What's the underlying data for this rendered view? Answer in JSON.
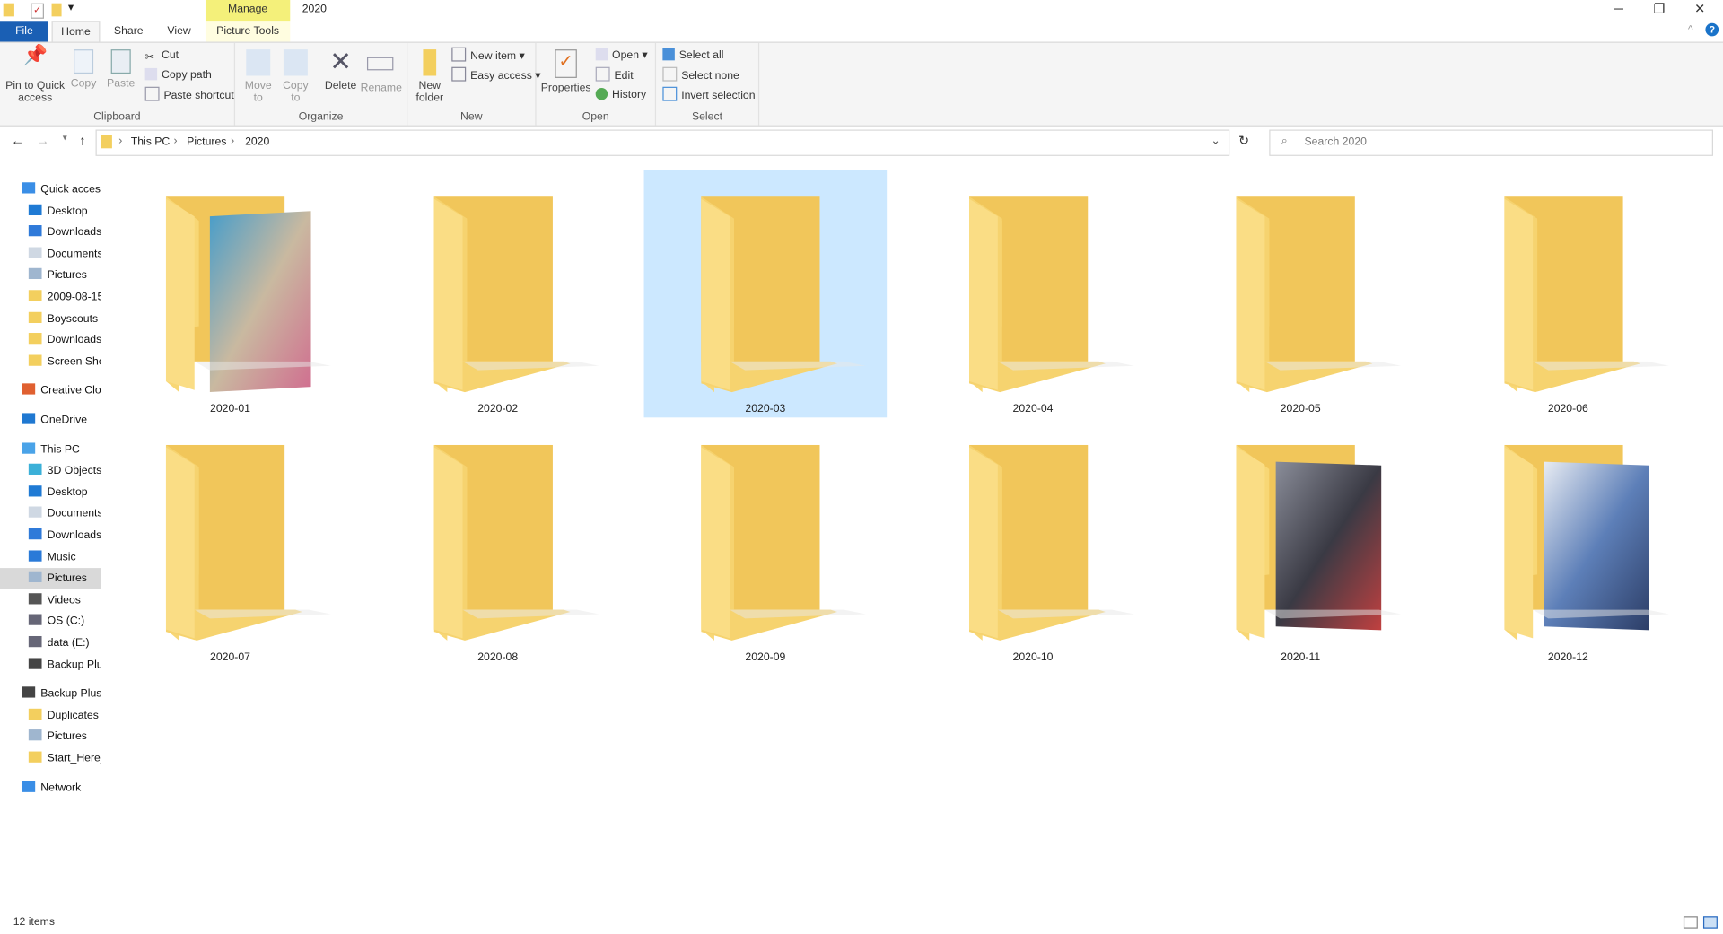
{
  "window": {
    "title": "2020",
    "context_tab": "Manage",
    "minimize": "─",
    "restore": "❐",
    "close": "✕"
  },
  "tabs": [
    {
      "label": "File"
    },
    {
      "label": "Home"
    },
    {
      "label": "Share"
    },
    {
      "label": "View"
    },
    {
      "label": "Picture Tools"
    }
  ],
  "ribbon": {
    "clipboard": {
      "label": "Clipboard",
      "pin": "Pin to Quick access",
      "copy": "Copy",
      "paste": "Paste",
      "cut": "Cut",
      "copy_path": "Copy path",
      "paste_shortcut": "Paste shortcut"
    },
    "organize": {
      "label": "Organize",
      "move_to": "Move to",
      "copy_to": "Copy to",
      "delete": "Delete",
      "rename": "Rename"
    },
    "new": {
      "label": "New",
      "new_folder": "New folder",
      "new_item": "New item ▾",
      "easy_access": "Easy access ▾"
    },
    "open": {
      "label": "Open",
      "properties": "Properties",
      "open": "Open ▾",
      "edit": "Edit",
      "history": "History"
    },
    "select": {
      "label": "Select",
      "select_all": "Select all",
      "select_none": "Select none",
      "invert": "Invert selection"
    }
  },
  "address": {
    "path": [
      "This PC",
      "Pictures",
      "2020"
    ],
    "search_placeholder": "Search 2020"
  },
  "sidebar": [
    {
      "label": "Quick access",
      "icon": "star-icon",
      "level": 0
    },
    {
      "label": "Desktop",
      "icon": "desktop-icon",
      "level": 1,
      "pinned": true
    },
    {
      "label": "Downloads",
      "icon": "download-icon",
      "level": 1,
      "pinned": true
    },
    {
      "label": "Documents",
      "icon": "document-icon",
      "level": 1,
      "pinned": true
    },
    {
      "label": "Pictures",
      "icon": "pictures-icon",
      "level": 1,
      "pinned": true
    },
    {
      "label": "2009-08-15",
      "icon": "folder-icon",
      "level": 1
    },
    {
      "label": "Boyscouts",
      "icon": "folder-icon",
      "level": 1
    },
    {
      "label": "Downloads",
      "icon": "folder-icon",
      "level": 1
    },
    {
      "label": "Screen Shots",
      "icon": "folder-icon",
      "level": 1
    },
    {
      "label": "Creative Cloud Files",
      "icon": "creative-cloud-icon",
      "level": 0,
      "gap": true
    },
    {
      "label": "OneDrive",
      "icon": "cloud-icon",
      "level": 0,
      "gap": true
    },
    {
      "label": "This PC",
      "icon": "computer-icon",
      "level": 0,
      "gap": true
    },
    {
      "label": "3D Objects",
      "icon": "cube-icon",
      "level": 1
    },
    {
      "label": "Desktop",
      "icon": "desktop-icon",
      "level": 1
    },
    {
      "label": "Documents",
      "icon": "document-icon",
      "level": 1
    },
    {
      "label": "Downloads",
      "icon": "download-icon",
      "level": 1
    },
    {
      "label": "Music",
      "icon": "music-icon",
      "level": 1
    },
    {
      "label": "Pictures",
      "icon": "pictures-icon",
      "level": 1,
      "selected": true
    },
    {
      "label": "Videos",
      "icon": "video-icon",
      "level": 1
    },
    {
      "label": "OS (C:)",
      "icon": "drive-icon",
      "level": 1
    },
    {
      "label": "data (E:)",
      "icon": "drive-icon",
      "level": 1
    },
    {
      "label": "Backup Plus",
      "icon": "external-drive-icon",
      "level": 1
    },
    {
      "label": "Backup Plus",
      "icon": "external-drive-icon",
      "level": 0,
      "gap": true
    },
    {
      "label": "Duplicates",
      "icon": "folder-icon",
      "level": 1
    },
    {
      "label": "Pictures",
      "icon": "pictures-icon",
      "level": 1
    },
    {
      "label": "Start_Here_",
      "icon": "folder-icon",
      "level": 1
    },
    {
      "label": "Network",
      "icon": "network-icon",
      "level": 0,
      "gap": true
    }
  ],
  "folders": [
    {
      "name": "2020-01",
      "thumb": "photo"
    },
    {
      "name": "2020-02"
    },
    {
      "name": "2020-03",
      "selected": true
    },
    {
      "name": "2020-04"
    },
    {
      "name": "2020-05"
    },
    {
      "name": "2020-06"
    },
    {
      "name": "2020-07"
    },
    {
      "name": "2020-08"
    },
    {
      "name": "2020-09"
    },
    {
      "name": "2020-10"
    },
    {
      "name": "2020-11",
      "thumb": "photo"
    },
    {
      "name": "2020-12",
      "thumb": "photo"
    }
  ],
  "status": {
    "count": "12 items"
  },
  "colors": {
    "file_tab": "#1a5fb4",
    "manage": "#f4f07a",
    "selection": "#cce8ff",
    "folder": "#f8d775"
  }
}
